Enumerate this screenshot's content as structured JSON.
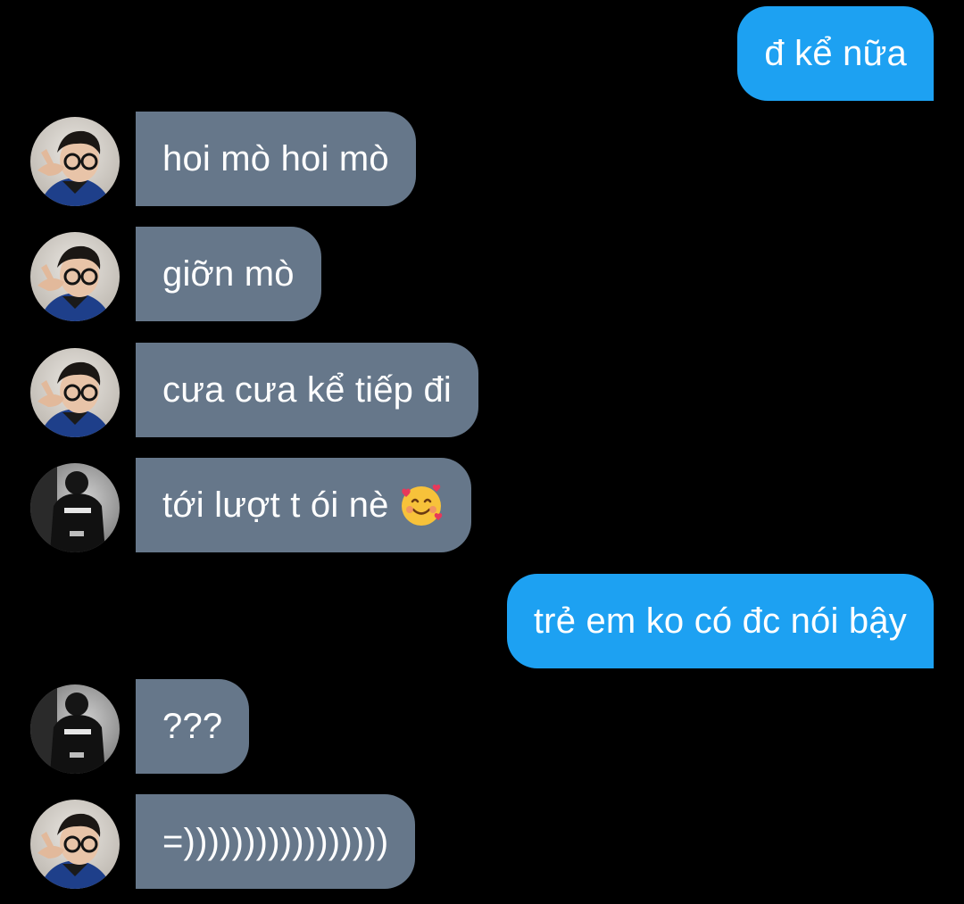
{
  "conversation": {
    "messages": [
      {
        "side": "out",
        "text": "đ kể nữa"
      },
      {
        "side": "in",
        "avatar": "glasses-boy",
        "text": "hoi mò hoi mò"
      },
      {
        "side": "in",
        "avatar": "glasses-boy",
        "text": "giỡn mò"
      },
      {
        "side": "in",
        "avatar": "glasses-boy",
        "text": "cưa cưa kể tiếp đi"
      },
      {
        "side": "in",
        "avatar": "jacket-back",
        "text": "tới lượt t ói nè",
        "emoji": "smiling-face-with-hearts"
      },
      {
        "side": "out",
        "text": "trẻ em ko có đc nói bậy"
      },
      {
        "side": "in",
        "avatar": "jacket-back",
        "text": "???"
      },
      {
        "side": "in",
        "avatar": "glasses-boy",
        "text": "=)))))))))))))))))"
      }
    ]
  },
  "colors": {
    "background": "#000000",
    "incoming_bubble": "#66778a",
    "outgoing_bubble": "#1da1f2",
    "text": "#ffffff"
  }
}
